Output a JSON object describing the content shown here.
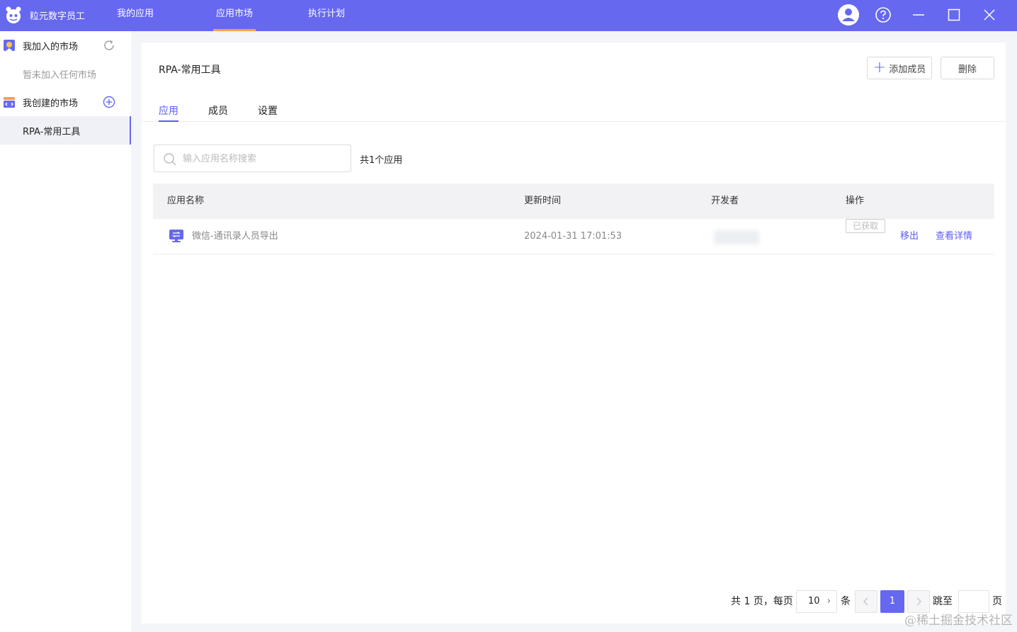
{
  "topbar": {
    "brand": "粒元数字员工",
    "tabs": [
      {
        "label": "我的应用",
        "active": false
      },
      {
        "label": "应用市场",
        "active": true
      },
      {
        "label": "执行计划",
        "active": false
      }
    ],
    "icons": [
      "user-avatar-icon",
      "help-icon",
      "minimize-icon",
      "maximize-icon",
      "close-icon"
    ]
  },
  "sidebar": {
    "joined_label": "我加入的市场",
    "joined_empty": "暂未加入任何市场",
    "created_label": "我创建的市场",
    "created_items": [
      {
        "label": "RPA-常用工具",
        "selected": true
      }
    ]
  },
  "main": {
    "title": "RPA-常用工具",
    "add_member_label": "添加成员",
    "delete_label": "删除",
    "tabs": [
      {
        "label": "应用",
        "active": true
      },
      {
        "label": "成员",
        "active": false
      },
      {
        "label": "设置",
        "active": false
      }
    ],
    "search_placeholder": "输入应用名称搜索",
    "count_text": "共1个应用",
    "table": {
      "columns": [
        "应用名称",
        "更新时间",
        "开发者",
        "操作"
      ],
      "rows": [
        {
          "name": "微信-通讯录人员导出",
          "updated": "2024-01-31 17:01:53",
          "status_tag": "已获取",
          "action_remove": "移出",
          "action_detail": "查看详情"
        }
      ]
    },
    "pagination": {
      "summary": "共 1 页，每页",
      "page_size": "10",
      "unit": "条",
      "current_page": "1",
      "jump_label": "跳至",
      "page_suffix": "页"
    }
  },
  "watermark": "@稀土掘金技术社区",
  "colors": {
    "accent": "#6668f0",
    "tab_underline": "#f2a548",
    "link": "#5b5cf0"
  }
}
